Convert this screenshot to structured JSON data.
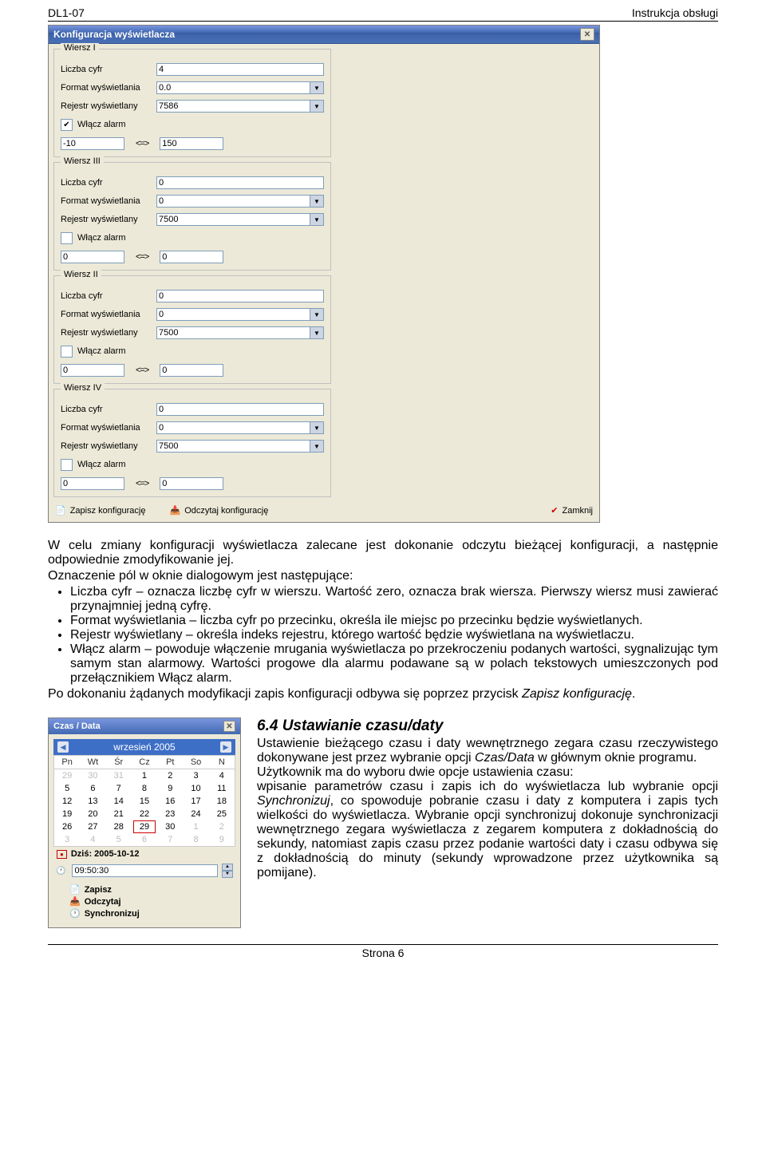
{
  "header": {
    "left": "DL1-07",
    "right": "Instrukcja obsługi"
  },
  "dialog": {
    "title": "Konfiguracja wyświetlacza",
    "labels": {
      "liczba": "Liczba cyfr",
      "format": "Format wyświetlania",
      "rejestr": "Rejestr wyświetlany",
      "wlacz": "Włącz alarm",
      "arrows": "<=>"
    },
    "groups": [
      {
        "title": "Wiersz I",
        "liczba": "4",
        "format": "0.0",
        "rejestr": "7586",
        "alarm": true,
        "r1": "-10",
        "r2": "150"
      },
      {
        "title": "Wiersz III",
        "liczba": "0",
        "format": "0",
        "rejestr": "7500",
        "alarm": false,
        "r1": "0",
        "r2": "0"
      },
      {
        "title": "Wiersz II",
        "liczba": "0",
        "format": "0",
        "rejestr": "7500",
        "alarm": false,
        "r1": "0",
        "r2": "0"
      },
      {
        "title": "Wiersz IV",
        "liczba": "0",
        "format": "0",
        "rejestr": "7500",
        "alarm": false,
        "r1": "0",
        "r2": "0"
      }
    ],
    "buttons": {
      "save": "Zapisz konfigurację",
      "read": "Odczytaj konfigurację",
      "close": "Zamknij"
    }
  },
  "para1": "W celu zmiany konfiguracji wyświetlacza zalecane jest dokonanie odczytu bieżącej konfiguracji, a następnie odpowiednie zmodyfikowanie jej.",
  "para2": "Oznaczenie pól w oknie dialogowym jest następujące:",
  "bullets": [
    "Liczba cyfr – oznacza liczbę cyfr w wierszu. Wartość zero, oznacza brak wiersza. Pierwszy wiersz musi zawierać przynajmniej jedną cyfrę.",
    "Format wyświetlania – liczba cyfr po przecinku, określa ile miejsc po przecinku będzie wyświetlanych.",
    "Rejestr wyświetlany – określa indeks rejestru, którego wartość będzie wyświetlana na wyświetlaczu.",
    "Włącz alarm – powoduje włączenie mrugania wyświetlacza po przekroczeniu podanych wartości, sygnalizując tym samym stan alarmowy. Wartości progowe dla alarmu podawane są w polach tekstowych umieszczonych pod przełącznikiem Włącz alarm."
  ],
  "para3a": "Po dokonaniu żądanych modyfikacji zapis konfiguracji odbywa się poprzez przycisk ",
  "para3b": "Zapisz konfigurację",
  "para3c": ".",
  "section": {
    "heading": "6.4 Ustawianie czasu/daty",
    "body": "Ustawienie bieżącego czasu i daty wewnętrznego zegara czasu rzeczywistego dokonywane jest przez wybranie opcji Czas/Data w głównym oknie programu.\nUżytkownik ma do wyboru dwie opcje ustawienia czasu:\nwpisanie parametrów czasu i zapis ich do wyświetlacza lub wybranie opcji Synchronizuj, co spowoduje pobranie czasu i daty z komputera i zapis tych wielkości do wyświetlacza. Wybranie opcji synchronizuj dokonuje synchronizacji wewnętrznego zegara wyświetlacza z zegarem komputera z dokładnością do sekundy, natomiast zapis czasu przez podanie wartości daty i czasu odbywa się z dokładnością do minuty (sekundy wprowadzone przez użytkownika są pomijane)."
  },
  "cal": {
    "title": "Czas / Data",
    "month": "wrzesień 2005",
    "days": [
      "Pn",
      "Wt",
      "Śr",
      "Cz",
      "Pt",
      "So",
      "N"
    ],
    "weeks": [
      [
        {
          "d": "29",
          "g": true
        },
        {
          "d": "30",
          "g": true
        },
        {
          "d": "31",
          "g": true
        },
        {
          "d": "1"
        },
        {
          "d": "2"
        },
        {
          "d": "3"
        },
        {
          "d": "4"
        }
      ],
      [
        {
          "d": "5"
        },
        {
          "d": "6"
        },
        {
          "d": "7"
        },
        {
          "d": "8"
        },
        {
          "d": "9"
        },
        {
          "d": "10"
        },
        {
          "d": "11"
        }
      ],
      [
        {
          "d": "12"
        },
        {
          "d": "13"
        },
        {
          "d": "14"
        },
        {
          "d": "15"
        },
        {
          "d": "16"
        },
        {
          "d": "17"
        },
        {
          "d": "18"
        }
      ],
      [
        {
          "d": "19"
        },
        {
          "d": "20"
        },
        {
          "d": "21"
        },
        {
          "d": "22"
        },
        {
          "d": "23"
        },
        {
          "d": "24"
        },
        {
          "d": "25"
        }
      ],
      [
        {
          "d": "26"
        },
        {
          "d": "27"
        },
        {
          "d": "28"
        },
        {
          "d": "29",
          "t": true
        },
        {
          "d": "30"
        },
        {
          "d": "1",
          "g": true
        },
        {
          "d": "2",
          "g": true
        }
      ],
      [
        {
          "d": "3",
          "g": true
        },
        {
          "d": "4",
          "g": true
        },
        {
          "d": "5",
          "g": true
        },
        {
          "d": "6",
          "g": true
        },
        {
          "d": "7",
          "g": true
        },
        {
          "d": "8",
          "g": true
        },
        {
          "d": "9",
          "g": true
        }
      ]
    ],
    "today_label": "Dziś: 2005-10-12",
    "time": "09:50:30",
    "btns": {
      "save": "Zapisz",
      "read": "Odczytaj",
      "sync": "Synchronizuj"
    }
  },
  "footer": "Strona 6"
}
